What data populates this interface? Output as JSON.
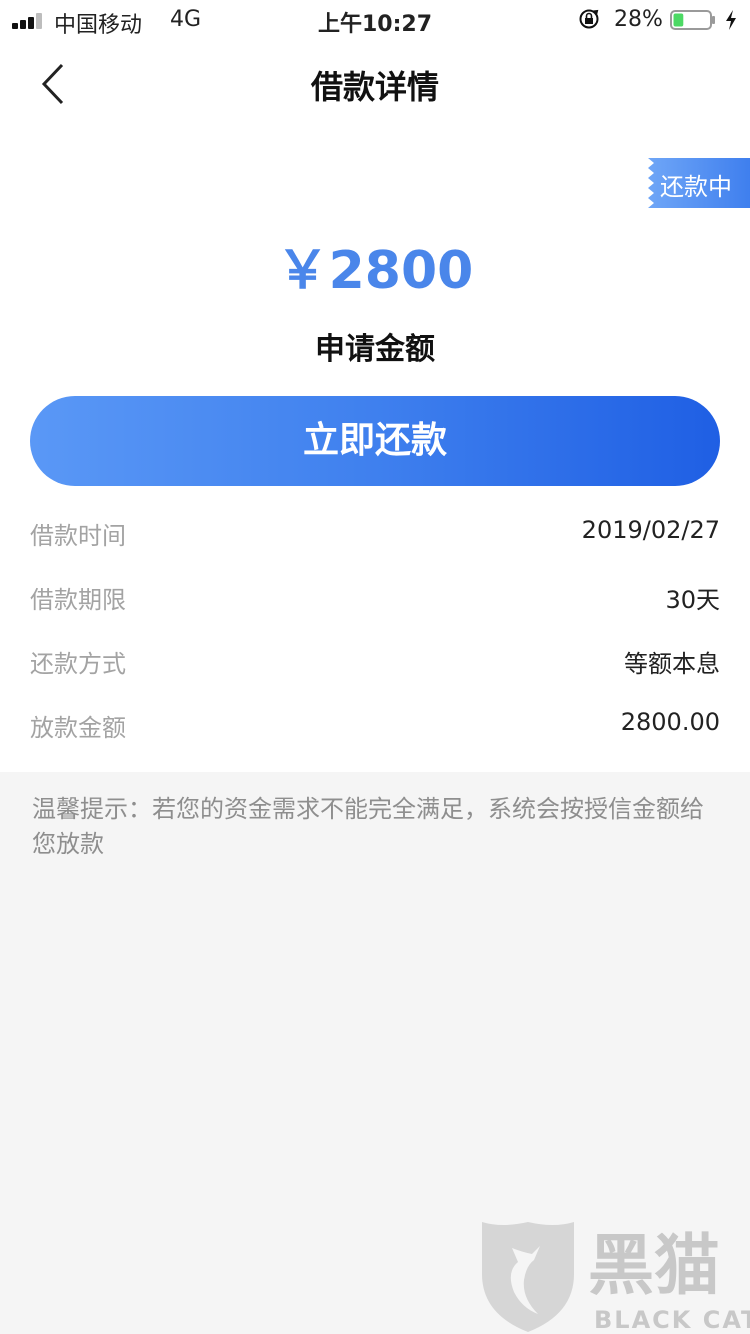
{
  "status_bar": {
    "carrier": "中国移动",
    "network": "4G",
    "time": "上午10:27",
    "battery_percent": "28%",
    "battery_level": 0.28
  },
  "nav": {
    "title": "借款详情"
  },
  "loan": {
    "status_badge": "还款中",
    "amount": "￥2800",
    "amount_label": "申请金额",
    "repay_button": "立即还款",
    "details": [
      {
        "label": "借款时间",
        "value": "2019/02/27"
      },
      {
        "label": "借款期限",
        "value": "30天"
      },
      {
        "label": "还款方式",
        "value": "等额本息"
      },
      {
        "label": "放款金额",
        "value": "2800.00"
      }
    ],
    "tip": "温馨提示：若您的资金需求不能完全满足，系统会按授信金额给您放款"
  },
  "watermark": {
    "cn": "黑猫",
    "en": "BLACK CAT"
  },
  "colors": {
    "accent": "#4a86ea",
    "button_start": "#5a98f6",
    "button_end": "#1f5fe4",
    "battery_fill": "#4cd964"
  }
}
